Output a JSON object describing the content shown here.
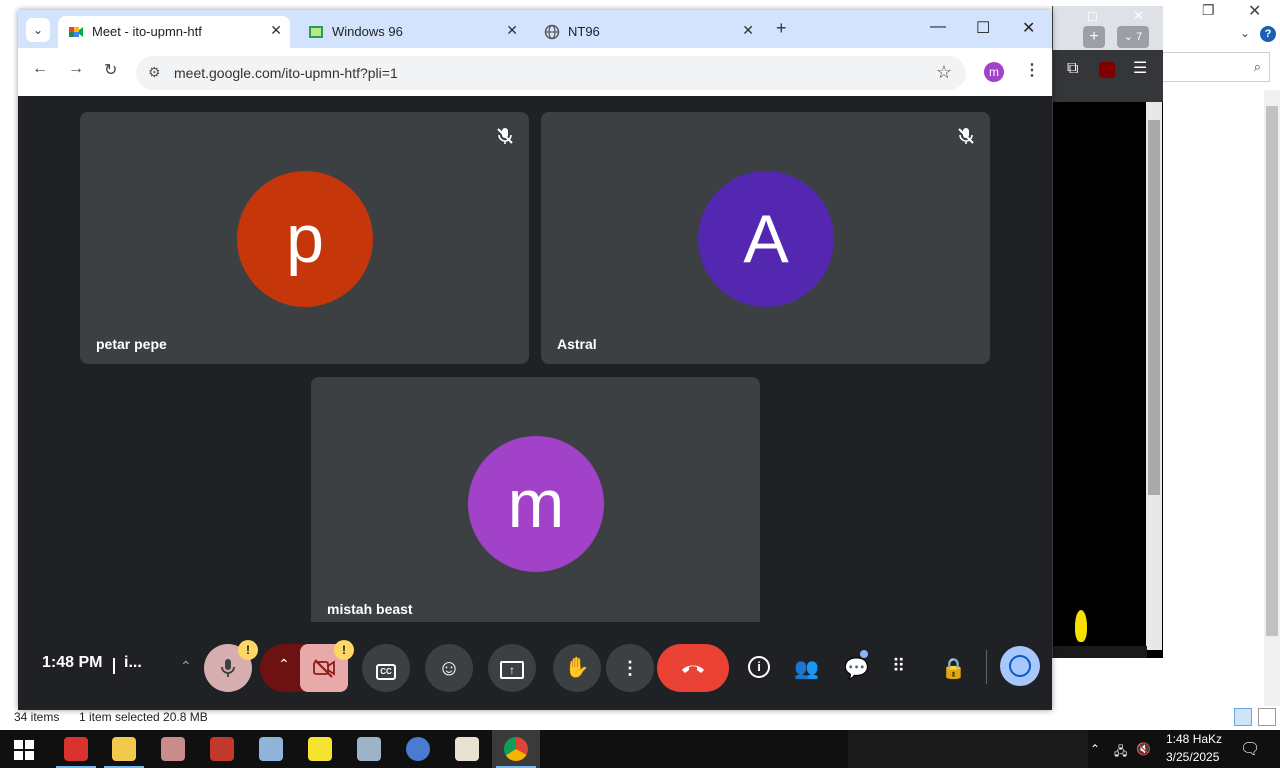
{
  "explorer": {
    "status_items": "34 items",
    "status_selected": "1 item selected  20.8 MB"
  },
  "background_browser": {
    "tab_count": "7"
  },
  "chrome": {
    "tabs": [
      {
        "label": "Meet - ito-upmn-htf",
        "icon": "google-meet-icon",
        "active": true
      },
      {
        "label": "Windows 96",
        "icon": "windows96-icon",
        "active": false
      },
      {
        "label": "NT96",
        "icon": "globe-icon",
        "active": false
      }
    ],
    "url": "meet.google.com/ito-upmn-htf?pli=1",
    "profile_initial": "m"
  },
  "meet": {
    "participants": [
      {
        "name": "petar pepe",
        "initial": "p",
        "color": "#c5360b",
        "muted": true
      },
      {
        "name": "Astral",
        "initial": "A",
        "color": "#5427b0",
        "muted": true
      },
      {
        "name": "mistah beast",
        "initial": "m",
        "color": "#a142c9",
        "muted": false
      }
    ],
    "time": "1:48 PM",
    "meeting_code": "i...",
    "people_count": "3",
    "warning_mark": "!",
    "colors": {
      "background": "#202124",
      "tile": "#3c4043",
      "end_call": "#ea4335",
      "accent": "#8ab4f8"
    }
  },
  "taskbar": {
    "time": "1:48 HaKz",
    "date": "3/25/2025"
  }
}
